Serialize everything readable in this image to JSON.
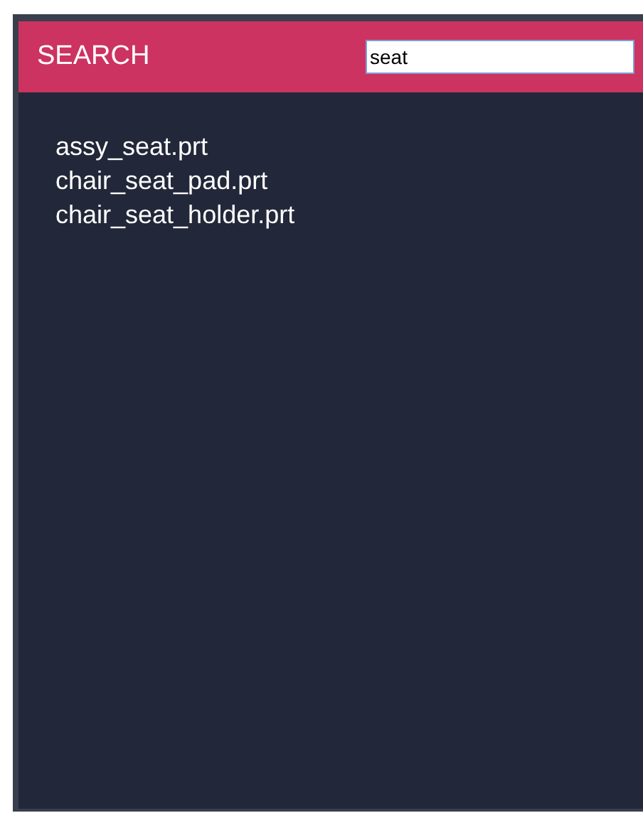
{
  "header": {
    "title": "SEARCH"
  },
  "search": {
    "value": "seat"
  },
  "results": [
    "assy_seat.prt",
    "chair_seat_pad.prt",
    "chair_seat_holder.prt"
  ]
}
